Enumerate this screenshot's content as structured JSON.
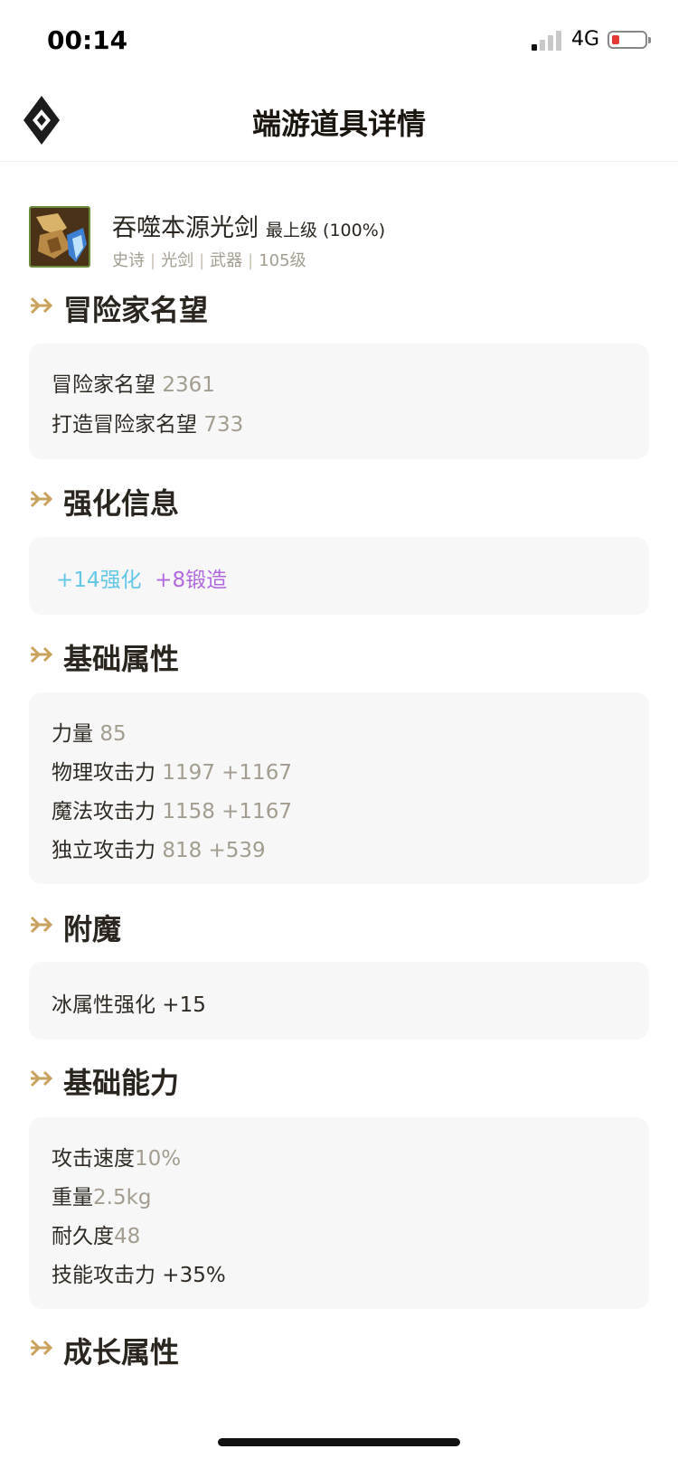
{
  "status_bar": {
    "time": "00:14",
    "network": "4G"
  },
  "header": {
    "title": "端游道具详情"
  },
  "item": {
    "name": "吞噬本源光剑",
    "grade": "最上级 (100%)",
    "tags": [
      "史诗",
      "光剑",
      "武器",
      "105级"
    ]
  },
  "sections": {
    "reputation": {
      "title": "冒险家名望",
      "rows": [
        {
          "label": "冒险家名望",
          "value": "2361"
        },
        {
          "label": "打造冒险家名望",
          "value": "733"
        }
      ]
    },
    "enhance": {
      "title": "强化信息",
      "reinforce": "+14强化",
      "forge": "+8锻造"
    },
    "base_attr": {
      "title": "基础属性",
      "rows": [
        {
          "label": "力量",
          "value": "85"
        },
        {
          "label": "物理攻击力",
          "value": "1197 +1167"
        },
        {
          "label": "魔法攻击力",
          "value": "1158 +1167"
        },
        {
          "label": "独立攻击力",
          "value": "818 +539"
        }
      ]
    },
    "enchant": {
      "title": "附魔",
      "rows": [
        {
          "label": "冰属性强化 +15"
        }
      ]
    },
    "base_ability": {
      "title": "基础能力",
      "rows": [
        {
          "label": "攻击速度",
          "value": "10%"
        },
        {
          "label": "重量",
          "value": "2.5kg"
        },
        {
          "label": "耐久度",
          "value": "48"
        },
        {
          "label": "技能攻击力 +35%"
        }
      ]
    },
    "growth": {
      "title": "成长属性"
    }
  },
  "colors": {
    "accent_gold": "#c9a35e",
    "value_gray": "#a39d90",
    "reinforce_cyan": "#63c7e8",
    "forge_purple": "#b269e0",
    "card_bg": "#f7f7f7"
  }
}
